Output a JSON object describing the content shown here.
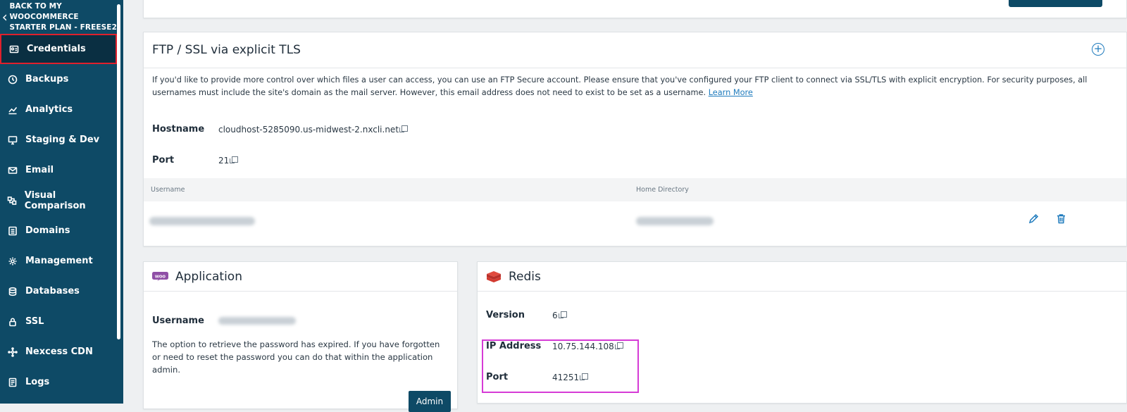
{
  "colors": {
    "sidebar_bg": "#0e4a66",
    "accent": "#1f7bbd",
    "active_outline": "#e0202c",
    "highlight": "#d63bd6"
  },
  "sidebar": {
    "back_lines": [
      "BACK TO MY",
      "WOOCOMMERCE",
      "STARTER PLAN - FREESE2"
    ],
    "items": [
      {
        "label": "Credentials",
        "icon": "id-card-icon",
        "active": true
      },
      {
        "label": "Backups",
        "icon": "history-icon"
      },
      {
        "label": "Analytics",
        "icon": "chart-icon"
      },
      {
        "label": "Staging & Dev",
        "icon": "monitor-icon"
      },
      {
        "label": "Email",
        "icon": "mail-icon"
      },
      {
        "label": "Visual Comparison",
        "icon": "compare-icon"
      },
      {
        "label": "Domains",
        "icon": "server-icon"
      },
      {
        "label": "Management",
        "icon": "gear-icon"
      },
      {
        "label": "Databases",
        "icon": "database-icon"
      },
      {
        "label": "SSL",
        "icon": "lock-icon"
      },
      {
        "label": "Nexcess CDN",
        "icon": "network-icon"
      },
      {
        "label": "Logs",
        "icon": "file-icon"
      }
    ]
  },
  "ftp": {
    "title": "FTP / SSL via explicit TLS",
    "description": "If you'd like to provide more control over which files a user can access, you can use an FTP Secure account. Please ensure that you've configured your FTP client to connect via SSL/TLS with explicit encryption. For security purposes, all usernames must include the site's domain as the mail server. However, this email address does not need to exist to be set as a username.",
    "learn_more": "Learn More",
    "hostname_label": "Hostname",
    "hostname_value": "cloudhost-5285090.us-midwest-2.nxcli.net",
    "port_label": "Port",
    "port_value": "21",
    "col_username": "Username",
    "col_home": "Home Directory"
  },
  "application": {
    "title": "Application",
    "username_label": "Username",
    "message": "The option to retrieve the password has expired. If you have forgotten or need to reset the password you can do that within the application admin.",
    "admin_button": "Admin"
  },
  "redis": {
    "title": "Redis",
    "version_label": "Version",
    "version_value": "6",
    "ip_label": "IP Address",
    "ip_value": "10.75.144.108",
    "port_label": "Port",
    "port_value": "41251"
  }
}
